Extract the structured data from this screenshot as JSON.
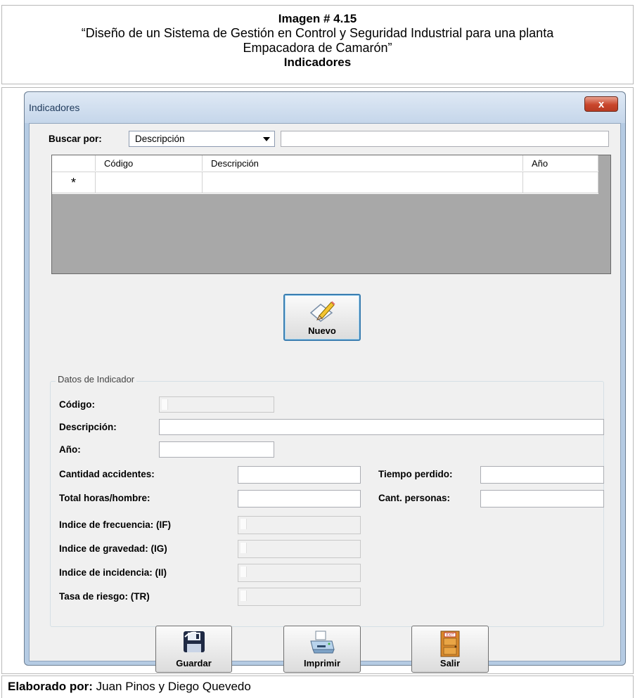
{
  "document": {
    "image_number": "Imagen # 4.15",
    "title_line1": "“Diseño de un Sistema de Gestión en Control y Seguridad Industrial para una planta",
    "title_line2": "Empacadora de Camarón”",
    "subtitle": "Indicadores",
    "footer_label": "Elaborado por:",
    "footer_authors": "Juan Pinos y Diego Quevedo"
  },
  "window": {
    "title": "Indicadores",
    "close_symbol": "x"
  },
  "search": {
    "label": "Buscar por:",
    "selected_option": "Descripción",
    "query": ""
  },
  "grid": {
    "columns": [
      "Código",
      "Descripción",
      "Año"
    ],
    "new_row_marker": "*",
    "rows": []
  },
  "new_button": {
    "label": "Nuevo",
    "icon": "pencil-edit-icon"
  },
  "form": {
    "group_title": "Datos de Indicador",
    "codigo_label": "Código:",
    "descripcion_label": "Descripción:",
    "anio_label": "Año:",
    "cantidad_accidentes_label": "Cantidad accidentes:",
    "total_horas_label": "Total horas/hombre:",
    "tiempo_perdido_label": "Tiempo perdido:",
    "cant_personas_label": "Cant. personas:",
    "if_label": "Indice de frecuencia: (IF)",
    "ig_label": "Indice de gravedad: (IG)",
    "ii_label": "Indice de incidencia: (II)",
    "tr_label": "Tasa de riesgo: (TR)"
  },
  "actions": {
    "save_label": "Guardar",
    "print_label": "Imprimir",
    "exit_label": "Salir",
    "save_icon": "floppy-disk-icon",
    "print_icon": "printer-icon",
    "exit_icon": "exit-door-icon"
  }
}
